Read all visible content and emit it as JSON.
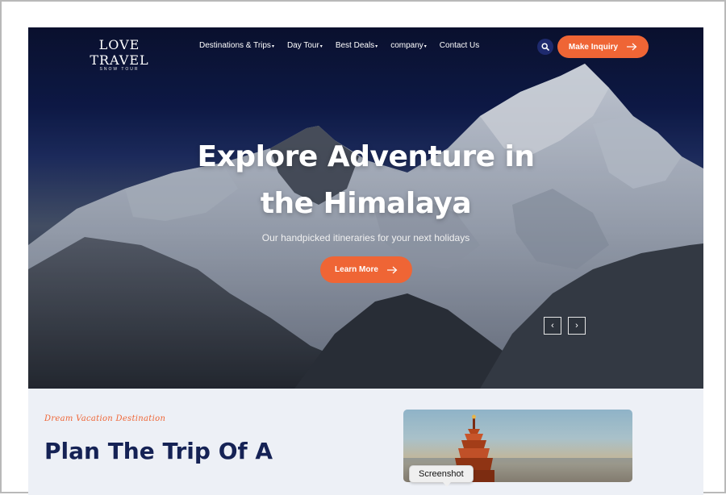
{
  "brand": {
    "name": "LOVE TRAVEL",
    "tagline": "SNOW TOUR"
  },
  "nav": {
    "items": [
      {
        "label": "Destinations & Trips",
        "caret": "▾"
      },
      {
        "label": "Day Tour",
        "caret": "▾"
      },
      {
        "label": "Best Deals",
        "caret": "▾"
      },
      {
        "label": "company",
        "caret": "▾"
      },
      {
        "label": "Contact Us",
        "caret": ""
      }
    ],
    "inquiry_label": "Make Inquiry"
  },
  "hero": {
    "title_line1": "Explore Adventure in",
    "title_line2": "the Himalaya",
    "subtitle": "Our handpicked itineraries for your next holidays",
    "cta_label": "Learn More",
    "prev_symbol": "‹",
    "next_symbol": "›"
  },
  "section": {
    "tagline": "Dream Vacation Destination",
    "title": "Plan The Trip Of A"
  },
  "tooltip": {
    "label": "Screenshot"
  },
  "colors": {
    "accent": "#ef6535",
    "navy": "#152255",
    "search_bg": "#1e2a6e",
    "section_bg": "#edf0f6"
  },
  "icons": {
    "search": "search-icon",
    "arrow": "arrow-right-icon",
    "prev": "chevron-left-icon",
    "next": "chevron-right-icon"
  }
}
